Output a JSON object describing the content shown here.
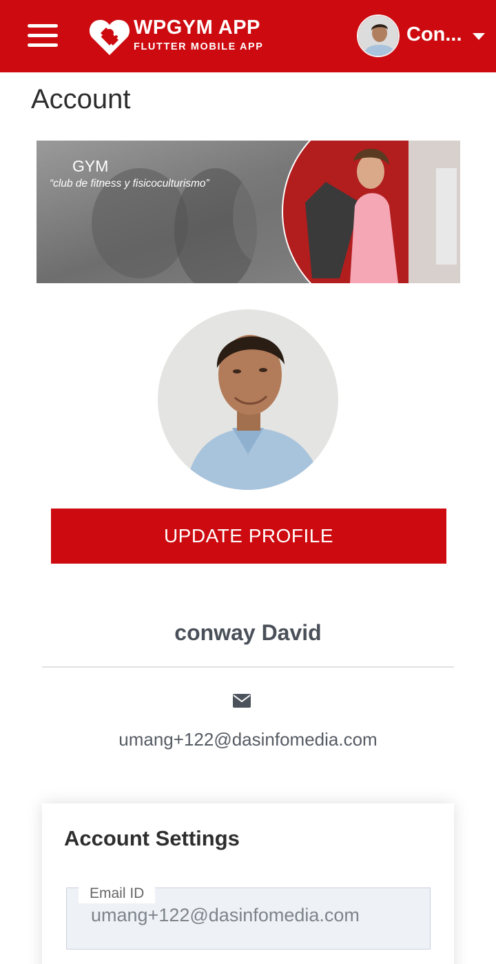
{
  "app": {
    "title": "WPGYM APP",
    "subtitle": "FLUTTER MOBILE APP",
    "user_short_name": "Con..."
  },
  "icons": {
    "menu": "hamburger-menu-icon",
    "logo": "heart-hand-logo-icon",
    "dropdown": "caret-down-icon",
    "email": "envelope-icon"
  },
  "colors": {
    "brand_red": "#cc0a0f",
    "text_dark": "#2d2d2d",
    "text_muted": "#555b63"
  },
  "page": {
    "title": "Account"
  },
  "banner": {
    "title": "GYM",
    "subtitle": "“club de fitness y fisicoculturismo”"
  },
  "profile": {
    "update_button": "UPDATE PROFILE",
    "name": "conway David",
    "email": "umang+122@dasinfomedia.com"
  },
  "settings": {
    "title": "Account Settings",
    "email_label": "Email ID",
    "email_value": "umang+122@dasinfomedia.com"
  }
}
